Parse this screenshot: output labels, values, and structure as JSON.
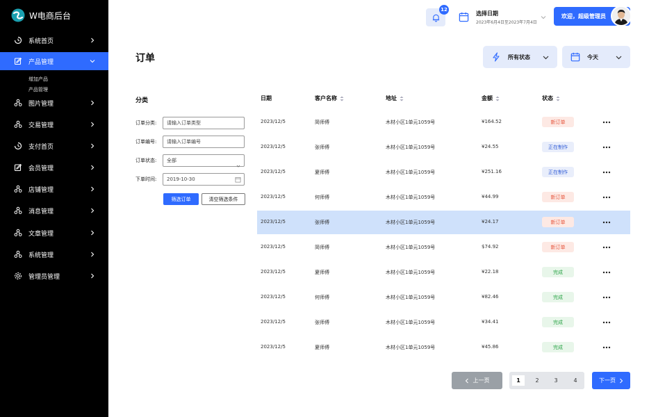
{
  "app": {
    "title": "W电商后台"
  },
  "sidebar": {
    "items": [
      {
        "label": "系统首页",
        "icon": "dashboard-icon"
      },
      {
        "label": "产品管理",
        "icon": "edit-icon",
        "active": true
      },
      {
        "label": "图片管理",
        "icon": "cluster-icon"
      },
      {
        "label": "交易管理",
        "icon": "cluster-icon"
      },
      {
        "label": "支付首页",
        "icon": "dashboard-icon"
      },
      {
        "label": "会员管理",
        "icon": "edit-icon"
      },
      {
        "label": "店铺管理",
        "icon": "cluster-icon"
      },
      {
        "label": "消息管理",
        "icon": "cluster-icon"
      },
      {
        "label": "文章管理",
        "icon": "cluster-icon"
      },
      {
        "label": "系统管理",
        "icon": "cluster-icon"
      },
      {
        "label": "管理员管理",
        "icon": "gear-icon"
      }
    ],
    "subitems": [
      "增加产品",
      "产品管理"
    ]
  },
  "topbar": {
    "notification_count": "12",
    "date_label": "选择日期",
    "date_range": "2023年6月4日至2023年7月4日",
    "welcome": "欢迎，超级管理员"
  },
  "page": {
    "title": "订单",
    "status_filter": "所有状态",
    "date_filter": "今天"
  },
  "filters": {
    "title": "分类",
    "type_label": "订单分类:",
    "type_placeholder": "请输入订单类型",
    "no_label": "订单编号:",
    "no_placeholder": "请输入订单编号",
    "status_label": "订单状态:",
    "status_value": "全部",
    "time_label": "下单时间:",
    "time_value": "2019-10-30",
    "search_button": "筛选订单",
    "clear_button": "清空筛选条件"
  },
  "table": {
    "headers": [
      "日期",
      "客户名称",
      "地址",
      "金额",
      "状态"
    ],
    "rows": [
      {
        "date": "2023/12/5",
        "customer": "简师傅",
        "address": "木材小区1单元1059号",
        "amount": "¥164.52",
        "status": "新订单",
        "status_type": "new"
      },
      {
        "date": "2023/12/5",
        "customer": "张师傅",
        "address": "木材小区1单元1059号",
        "amount": "¥24.55",
        "status": "正在制作",
        "status_type": "making"
      },
      {
        "date": "2023/12/5",
        "customer": "夏师傅",
        "address": "木材小区1单元1059号",
        "amount": "¥251.16",
        "status": "正在制作",
        "status_type": "making"
      },
      {
        "date": "2023/12/5",
        "customer": "何师傅",
        "address": "木材小区1单元1059号",
        "amount": "¥44.99",
        "status": "新订单",
        "status_type": "new"
      },
      {
        "date": "2023/12/5",
        "customer": "张师傅",
        "address": "木材小区1单元1059号",
        "amount": "¥24.17",
        "status": "新订单",
        "status_type": "new",
        "highlighted": true
      },
      {
        "date": "2023/12/5",
        "customer": "简师傅",
        "address": "木材小区1单元1059号",
        "amount": "$74.92",
        "status": "新订单",
        "status_type": "new"
      },
      {
        "date": "2023/12/5",
        "customer": "夏师傅",
        "address": "木材小区1单元1059号",
        "amount": "¥22.18",
        "status": "完成",
        "status_type": "done"
      },
      {
        "date": "2023/12/5",
        "customer": "何师傅",
        "address": "木材小区1单元1059号",
        "amount": "¥82.46",
        "status": "完成",
        "status_type": "done"
      },
      {
        "date": "2023/12/5",
        "customer": "张师傅",
        "address": "木材小区1单元1059号",
        "amount": "¥34.41",
        "status": "完成",
        "status_type": "done"
      },
      {
        "date": "2023/12/5",
        "customer": "夏师傅",
        "address": "木材小区1单元1059号",
        "amount": "¥45.86",
        "status": "完成",
        "status_type": "done"
      }
    ]
  },
  "pagination": {
    "prev": "上一页",
    "next": "下一页",
    "pages": [
      "1",
      "2",
      "3",
      "4"
    ],
    "current": "1"
  },
  "colors": {
    "accent": "#2f6bff",
    "sidebar": "#000000",
    "highlight_row": "#cfe1fb"
  }
}
